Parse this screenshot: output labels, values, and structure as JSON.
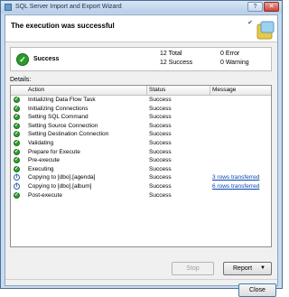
{
  "window": {
    "title": "SQL Server Import and Export Wizard"
  },
  "header": {
    "heading": "The execution was successful"
  },
  "summary": {
    "status": "Success",
    "total": "12 Total",
    "success": "12 Success",
    "errors": "0  Error",
    "warnings": "0  Warning"
  },
  "details_label": "Details:",
  "table": {
    "columns": [
      "Action",
      "Status",
      "Message"
    ],
    "rows": [
      {
        "icon": "success-icon",
        "action": "Initializing Data Flow Task",
        "status": "Success",
        "message": ""
      },
      {
        "icon": "success-icon",
        "action": "Initializing Connections",
        "status": "Success",
        "message": ""
      },
      {
        "icon": "success-icon",
        "action": "Setting SQL Command",
        "status": "Success",
        "message": ""
      },
      {
        "icon": "success-icon",
        "action": "Setting Source Connection",
        "status": "Success",
        "message": ""
      },
      {
        "icon": "success-icon",
        "action": "Setting Destination Connection",
        "status": "Success",
        "message": ""
      },
      {
        "icon": "success-icon",
        "action": "Validating",
        "status": "Success",
        "message": ""
      },
      {
        "icon": "success-icon",
        "action": "Prepare for Execute",
        "status": "Success",
        "message": ""
      },
      {
        "icon": "success-icon",
        "action": "Pre-execute",
        "status": "Success",
        "message": ""
      },
      {
        "icon": "success-icon",
        "action": "Executing",
        "status": "Success",
        "message": ""
      },
      {
        "icon": "info-icon",
        "action": "Copying to [dbo].[agenda]",
        "status": "Success",
        "message": "3 rows transferred"
      },
      {
        "icon": "info-icon",
        "action": "Copying to [dbo].[album]",
        "status": "Success",
        "message": "6 rows transferred"
      },
      {
        "icon": "success-icon",
        "action": "Post-execute",
        "status": "Success",
        "message": ""
      }
    ]
  },
  "buttons": {
    "stop": "Stop",
    "report": "Report",
    "close": "Close"
  },
  "colors": {
    "success": "#2f9f2f",
    "link": "#0645ad"
  }
}
